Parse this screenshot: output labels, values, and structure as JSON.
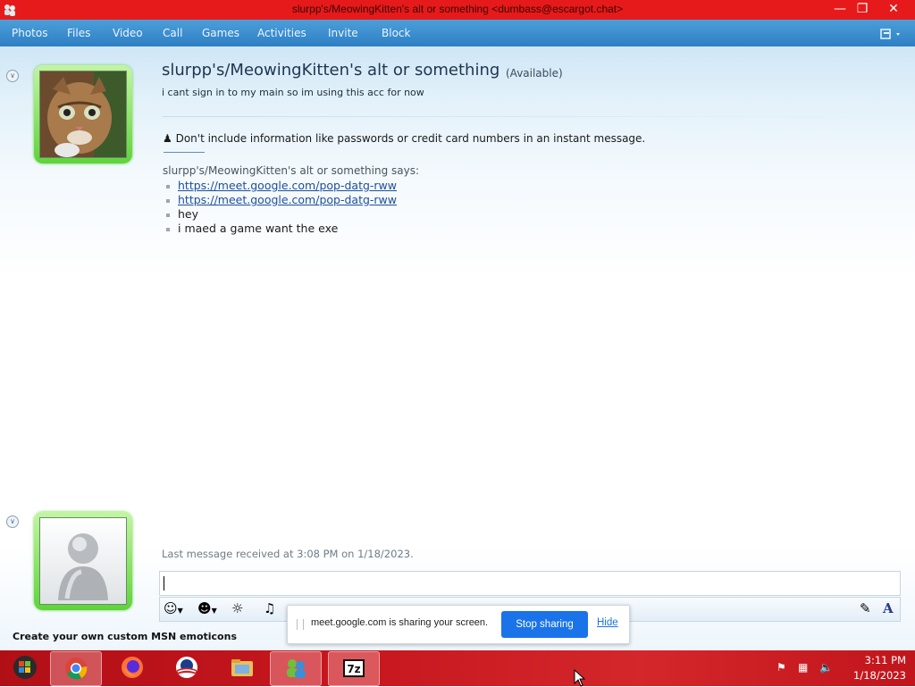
{
  "window": {
    "title": "slurpp's/MeowingKitten's alt or something <dumbass@escargot.chat>"
  },
  "menu": [
    "Photos",
    "Files",
    "Video",
    "Call",
    "Games",
    "Activities",
    "Invite",
    "Block"
  ],
  "contact": {
    "name": "slurpp's/MeowingKitten's alt or something",
    "status": "(Available)",
    "personal_message": "i cant sign in to my main so im using this acc for now"
  },
  "conversation": {
    "warning": "Don't include information like passwords or credit card numbers in an instant message.",
    "sender_says": "slurpp's/MeowingKitten's alt or something says:",
    "messages": [
      {
        "text": "https://meet.google.com/pop-datg-rww",
        "link": true
      },
      {
        "text": "https://meet.google.com/pop-datg-rww",
        "link": true
      },
      {
        "text": "hey",
        "link": false
      },
      {
        "text": "i maed a game want the exe",
        "link": false
      }
    ],
    "last_message": "Last message received at 3:08 PM on 1/18/2023."
  },
  "promo": "Create your own custom MSN emoticons",
  "share_bar": {
    "text": "meet.google.com is sharing your screen.",
    "stop_label": "Stop sharing",
    "hide_label": "Hide"
  },
  "taskbar": {
    "apps": [
      "windows-live-messenger",
      "chrome",
      "firefox",
      "obama-app",
      "file-explorer",
      "messenger-contacts",
      "7zip"
    ],
    "time": "3:11 PM",
    "date": "1/18/2023"
  },
  "colors": {
    "titlebar": "#e61a1a",
    "menubar": "#2d7fc4",
    "frame_green": "#5ed43a",
    "link": "#1c4f9c",
    "stop_button": "#1a73e8",
    "taskbar": "#c8171f"
  }
}
